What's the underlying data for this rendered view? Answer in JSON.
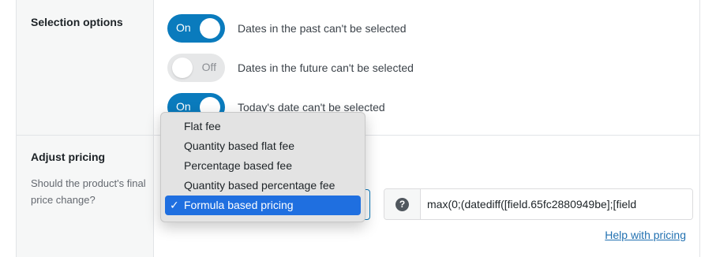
{
  "selection": {
    "title": "Selection options",
    "toggles": [
      {
        "state": "On",
        "text": "Dates in the past can't be selected"
      },
      {
        "state": "Off",
        "text": "Dates in the future can't be selected"
      },
      {
        "state": "On",
        "text": "Today's date can't be selected"
      }
    ]
  },
  "pricing": {
    "title": "Adjust pricing",
    "description": "Should the product's final price change?",
    "dropdown": {
      "options": [
        "Flat fee",
        "Quantity based flat fee",
        "Percentage based fee",
        "Quantity based percentage fee",
        "Formula based pricing"
      ],
      "selected_index": 4,
      "check_glyph": "✓"
    },
    "formula": {
      "help_symbol": "?",
      "value": "max(0;(datediff([field.65fc2880949be];[field"
    },
    "help_link": "Help with pricing"
  },
  "colors": {
    "toggle_on": "#0a7bbd",
    "toggle_off": "#e6e7e8",
    "selected_option": "#1f6fe0",
    "link": "#2271b1"
  }
}
